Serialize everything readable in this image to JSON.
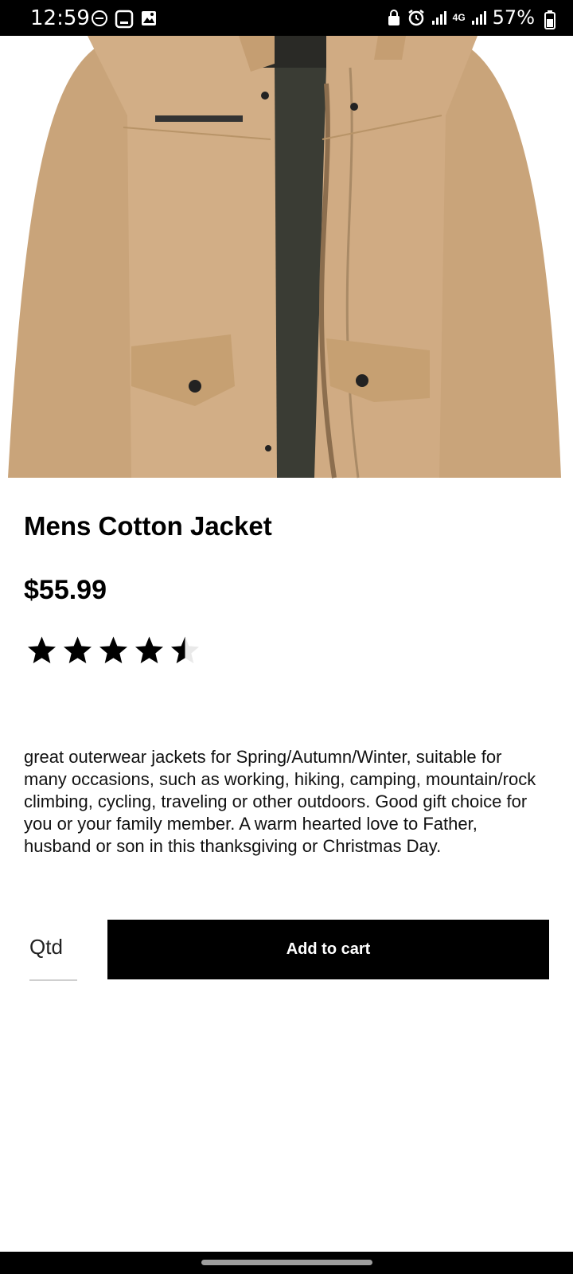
{
  "status_bar": {
    "time": "12:59",
    "battery_text": "57%",
    "network": "4G",
    "icons": [
      "dnd-icon",
      "screen-icon",
      "gallery-icon",
      "lock-icon",
      "alarm-icon",
      "signal-icon",
      "signal-icon",
      "battery-icon"
    ]
  },
  "product": {
    "title": "Mens Cotton Jacket",
    "price": "$55.99",
    "rating": 4.5,
    "rating_max": 5,
    "description": "great outerwear jackets for Spring/Autumn/Winter, suitable for many occasions, such as working, hiking, camping, mountain/rock climbing, cycling, traveling or other outdoors. Good gift choice for you or your family member. A warm hearted love to Father, husband or son in this thanksgiving or Christmas Day."
  },
  "cart": {
    "qty_placeholder": "Qtd",
    "add_label": "Add to cart"
  },
  "colors": {
    "jacket": "#cfac84",
    "lining": "#3a3c34",
    "button": "#000000"
  }
}
